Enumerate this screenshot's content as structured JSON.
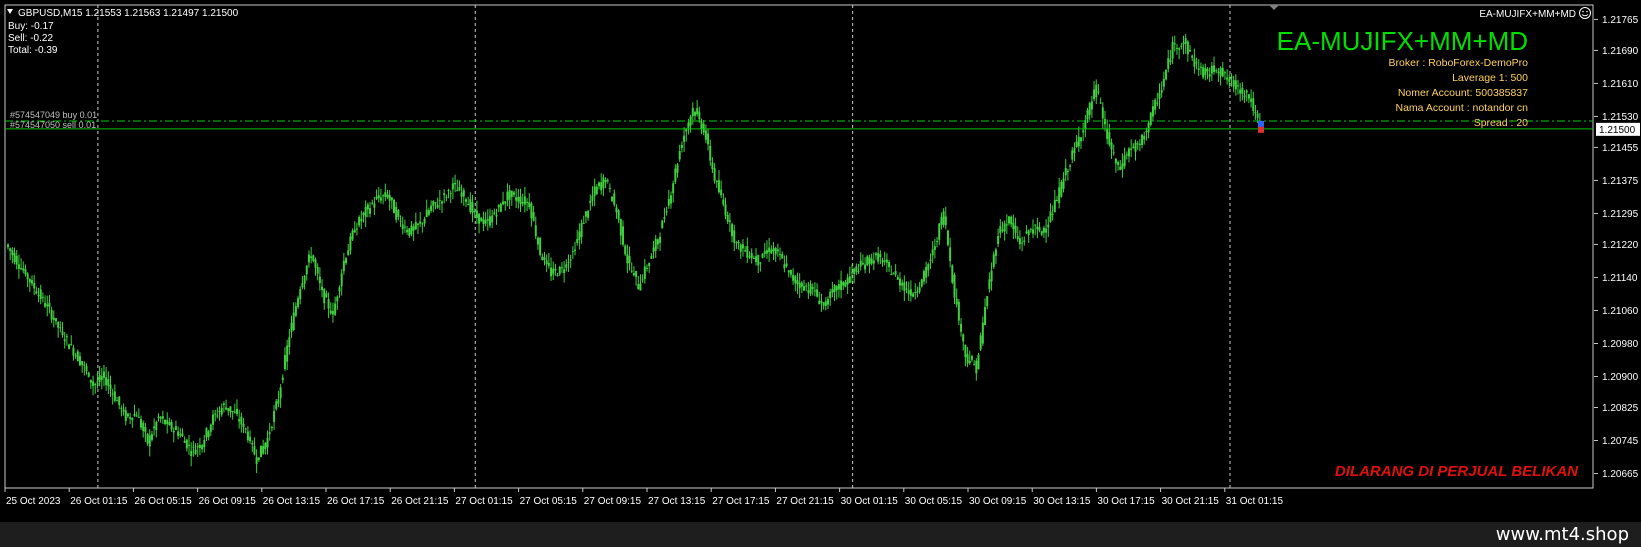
{
  "header": {
    "symbol_line": "GBPUSD,M15  1.21553 1.21563 1.21497 1.21500",
    "buy": "Buy: -0.17",
    "sell": "Sell: -0.22",
    "total": "Total: -0.39",
    "ea_name_small": "EA-MUJIFX+MM+MD"
  },
  "ea_panel": {
    "title": "EA-MUJIFX+MM+MD",
    "broker": "Broker : RoboForex-DemoPro",
    "leverage": "Laverage  1: 500",
    "account_number": "Nomer Account: 500385837",
    "account_name": "Nama Account    : notandor cn",
    "spread": "Spread : 20",
    "warning": "DILARANG DI PERJUAL BELIKAN"
  },
  "orders": [
    {
      "label": "#574547049 buy 0.01",
      "price": 1.21519,
      "color": "#00c800"
    },
    {
      "label": "#574547050 sell 0.01",
      "price": 1.215,
      "color": "#00c800"
    }
  ],
  "current_price_label": "1.21500",
  "colors": {
    "candle": "#40d040",
    "grid": "#c8c8c8",
    "order_line": "#00b000",
    "title": "#00e000",
    "info": "#ffd060",
    "warning": "#e01010",
    "background": "#000000"
  },
  "chart_data": {
    "type": "line",
    "symbol": "GBPUSD",
    "timeframe": "M15",
    "ylim": [
      1.2063,
      1.218
    ],
    "y_ticks": [
      "1.21765",
      "1.21690",
      "1.21610",
      "1.21530",
      "1.21455",
      "1.21375",
      "1.21295",
      "1.21220",
      "1.21140",
      "1.21060",
      "1.20980",
      "1.20900",
      "1.20825",
      "1.20745",
      "1.20665"
    ],
    "x_ticks": [
      "25 Oct 2023",
      "26 Oct 01:15",
      "26 Oct 05:15",
      "26 Oct 09:15",
      "26 Oct 13:15",
      "26 Oct 17:15",
      "26 Oct 21:15",
      "27 Oct 01:15",
      "27 Oct 05:15",
      "27 Oct 09:15",
      "27 Oct 13:15",
      "27 Oct 17:15",
      "27 Oct 21:15",
      "30 Oct 01:15",
      "30 Oct 05:15",
      "30 Oct 09:15",
      "30 Oct 13:15",
      "30 Oct 17:15",
      "30 Oct 21:15",
      "31 Oct 01:15"
    ],
    "series": [
      {
        "values": [
          1.2122,
          1.2118,
          1.2114,
          1.211,
          1.2106,
          1.2101,
          1.2097,
          1.2093,
          1.2088,
          1.209,
          1.2085,
          1.208,
          1.2081,
          1.2074,
          1.208,
          1.2078,
          1.2076,
          1.2072,
          1.2074,
          1.208,
          1.2083,
          1.2081,
          1.2077,
          1.207,
          1.2075,
          1.2085,
          1.21,
          1.2112,
          1.212,
          1.211,
          1.2105,
          1.2118,
          1.2126,
          1.213,
          1.2133,
          1.2134,
          1.2128,
          1.2125,
          1.2127,
          1.2131,
          1.2133,
          1.2136,
          1.2134,
          1.2129,
          1.2127,
          1.213,
          1.2134,
          1.2133,
          1.2132,
          1.212,
          1.2115,
          1.2116,
          1.212,
          1.2128,
          1.2135,
          1.2138,
          1.213,
          1.2118,
          1.2112,
          1.2118,
          1.2125,
          1.2135,
          1.2147,
          1.2155,
          1.215,
          1.2138,
          1.213,
          1.2122,
          1.212,
          1.2118,
          1.2121,
          1.2119,
          1.2114,
          1.2112,
          1.2111,
          1.2107,
          1.2111,
          1.2113,
          1.2116,
          1.2118,
          1.2119,
          1.2116,
          1.2113,
          1.211,
          1.2113,
          1.212,
          1.213,
          1.211,
          1.2095,
          1.2092,
          1.211,
          1.2125,
          1.2128,
          1.2122,
          1.2126,
          1.2125,
          1.213,
          1.2138,
          1.2145,
          1.2152,
          1.216,
          1.2148,
          1.214,
          1.2145,
          1.2146,
          1.2153,
          1.216,
          1.217,
          1.2171,
          1.2166,
          1.2163,
          1.2165,
          1.2162,
          1.216,
          1.2158,
          1.215
        ],
        "color": "#40d040"
      }
    ]
  }
}
